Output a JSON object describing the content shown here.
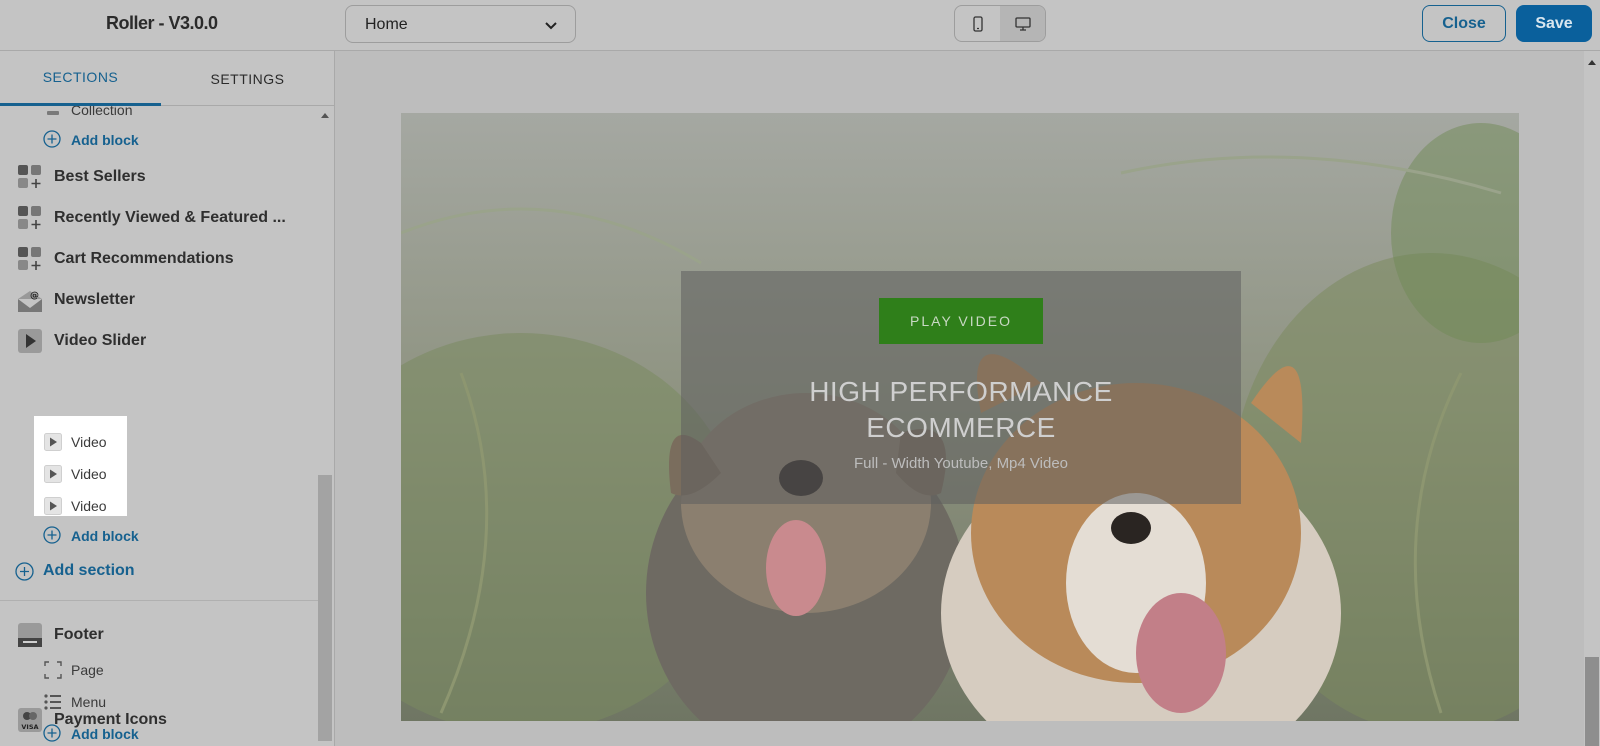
{
  "header": {
    "app_title": "Roller - V3.0.0",
    "page_select_value": "Home",
    "device_mobile_icon": "mobile-icon",
    "device_desktop_icon": "desktop-icon",
    "close_label": "Close",
    "save_label": "Save"
  },
  "sidebar": {
    "tabs": [
      {
        "label": "SECTIONS",
        "active": true
      },
      {
        "label": "SETTINGS",
        "active": false
      }
    ],
    "partial_item": "Collection",
    "add_block_label": "Add block",
    "sections": [
      {
        "label": "Best Sellers",
        "icon": "blocks-icon"
      },
      {
        "label": "Recently Viewed & Featured ...",
        "icon": "blocks-icon"
      },
      {
        "label": "Cart Recommendations",
        "icon": "blocks-icon"
      },
      {
        "label": "Newsletter",
        "icon": "newsletter-icon"
      },
      {
        "label": "Video Slider",
        "icon": "video-icon"
      }
    ],
    "video_blocks": [
      "Video",
      "Video",
      "Video"
    ],
    "add_section_label": "Add section",
    "footer": {
      "label": "Footer",
      "icon": "footer-icon",
      "blocks": [
        {
          "label": "Page",
          "icon": "page-icon"
        },
        {
          "label": "Menu",
          "icon": "menu-icon"
        }
      ]
    },
    "payment_icons": {
      "label": "Payment Icons",
      "icon": "payment-icon",
      "badge": "VISA"
    }
  },
  "preview": {
    "play_button_label": "PLAY VIDEO",
    "title_line1": "HIGH PERFORMANCE",
    "title_line2": "ECOMMERCE",
    "subtitle": "Full - Width Youtube, Mp4 Video"
  },
  "colors": {
    "accent": "#16618f",
    "save_bg": "#0a609c",
    "play_button_bg": "#2f7f1a",
    "dim_overlay": "#bdbdbd"
  }
}
